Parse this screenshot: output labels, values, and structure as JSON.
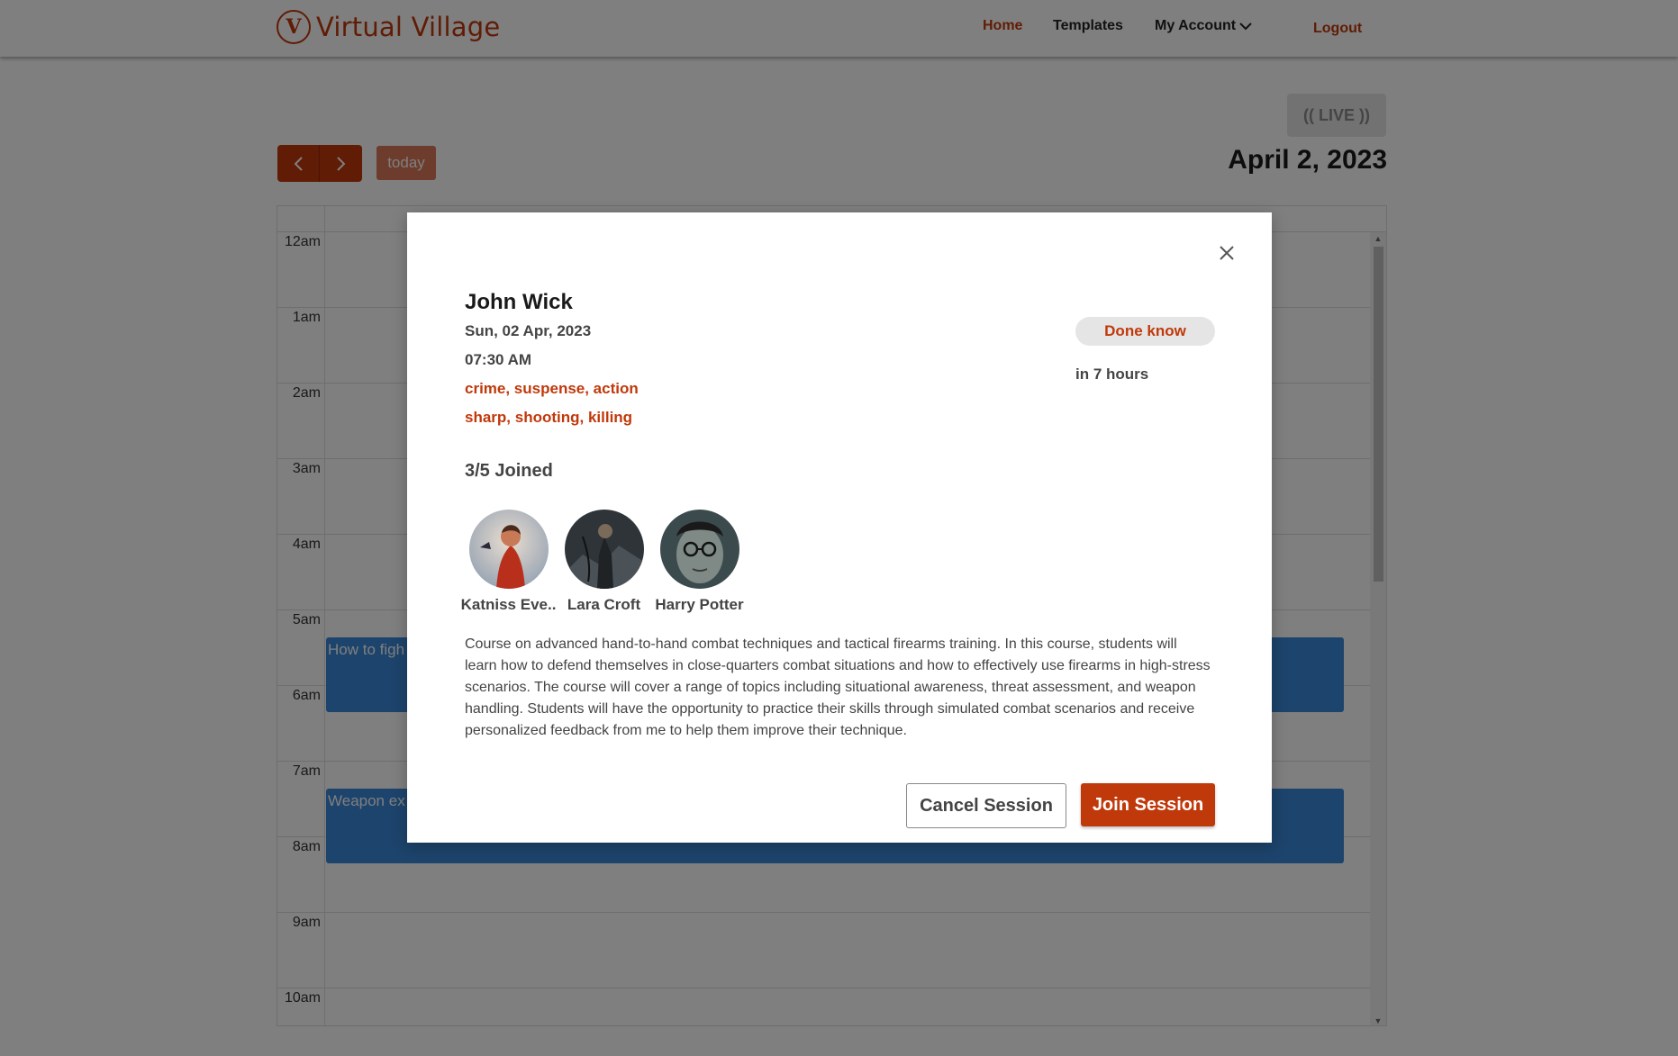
{
  "header": {
    "logo_text": "Virtual Village",
    "nav": {
      "home": "Home",
      "templates": "Templates",
      "my_account": "My Account",
      "logout": "Logout"
    }
  },
  "toolbar": {
    "live_label": "(( LIVE ))",
    "prev_icon": "chevron-left-icon",
    "next_icon": "chevron-right-icon",
    "today_label": "today",
    "current_date": "April 2, 2023"
  },
  "calendar": {
    "hours": [
      "12am",
      "1am",
      "2am",
      "3am",
      "4am",
      "5am",
      "6am",
      "7am",
      "8am",
      "9am",
      "10am"
    ],
    "events": [
      {
        "title": "How to figh"
      },
      {
        "title": "Weapon ex"
      }
    ],
    "event_color": "#3a88d8"
  },
  "modal": {
    "title": "John Wick",
    "date": "Sun, 02 Apr, 2023",
    "time": "07:30 AM",
    "genres": "crime, suspense, action",
    "tags": "sharp, shooting, killing",
    "status": "Done know",
    "countdown": "in 7 hours",
    "joined": "3/5 Joined",
    "members": [
      {
        "name": "Katniss Eve.."
      },
      {
        "name": "Lara Croft"
      },
      {
        "name": "Harry Potter"
      }
    ],
    "description": "Course on advanced hand-to-hand combat techniques and tactical firearms training. In this course, students will learn how to defend themselves in close-quarters combat situations and how to effectively use firearms in high-stress scenarios. The course will cover a range of topics including situational awareness, threat assessment, and weapon handling. Students will have the opportunity to practice their skills through simulated combat scenarios and receive personalized feedback from me to help them improve their technique.",
    "cancel_label": "Cancel Session",
    "join_label": "Join Session"
  },
  "colors": {
    "brand": "#c0390b",
    "event": "#3a88d8"
  }
}
